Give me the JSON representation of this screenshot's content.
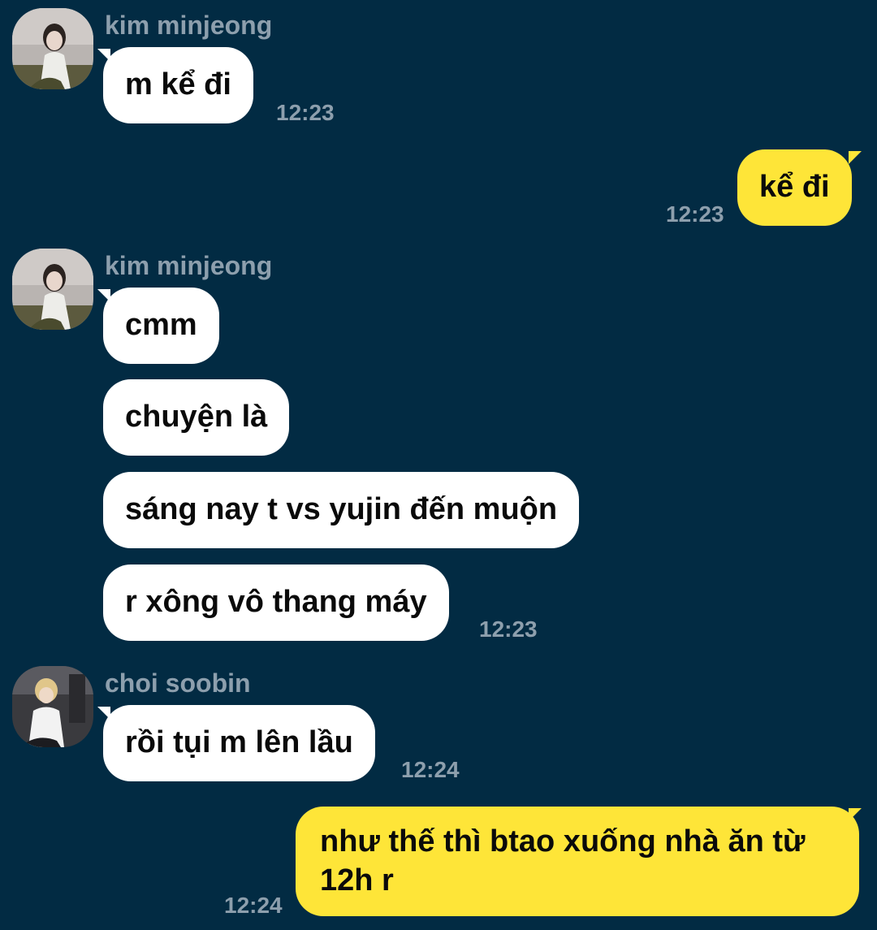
{
  "participants": {
    "kim": {
      "name": "kim minjeong",
      "avatar_icon": "girl-photo-avatar"
    },
    "choi": {
      "name": "choi soobin",
      "avatar_icon": "boy-photo-avatar"
    }
  },
  "messages": [
    {
      "sender": "kim minjeong",
      "text": "m kể đi",
      "time": "12:23"
    },
    {
      "sender": "me",
      "text": "kể đi",
      "time": "12:23"
    },
    {
      "sender": "kim minjeong",
      "text": "cmm"
    },
    {
      "sender": "kim minjeong",
      "text": "chuyện là"
    },
    {
      "sender": "kim minjeong",
      "text": "sáng nay t vs yujin đến muộn"
    },
    {
      "sender": "kim minjeong",
      "text": "r xông vô thang máy",
      "time": "12:23"
    },
    {
      "sender": "choi soobin",
      "text": "rồi tụi m lên lầu",
      "time": "12:24"
    },
    {
      "sender": "me",
      "text_line1": "như thế thì btao xuống nhà ăn từ",
      "text_line2": "12h r",
      "time": "12:24"
    }
  ],
  "colors": {
    "background": "#022B43",
    "incoming_bubble": "#FFFFFF",
    "outgoing_bubble": "#FEE538",
    "meta_text": "#8D9FAD"
  }
}
